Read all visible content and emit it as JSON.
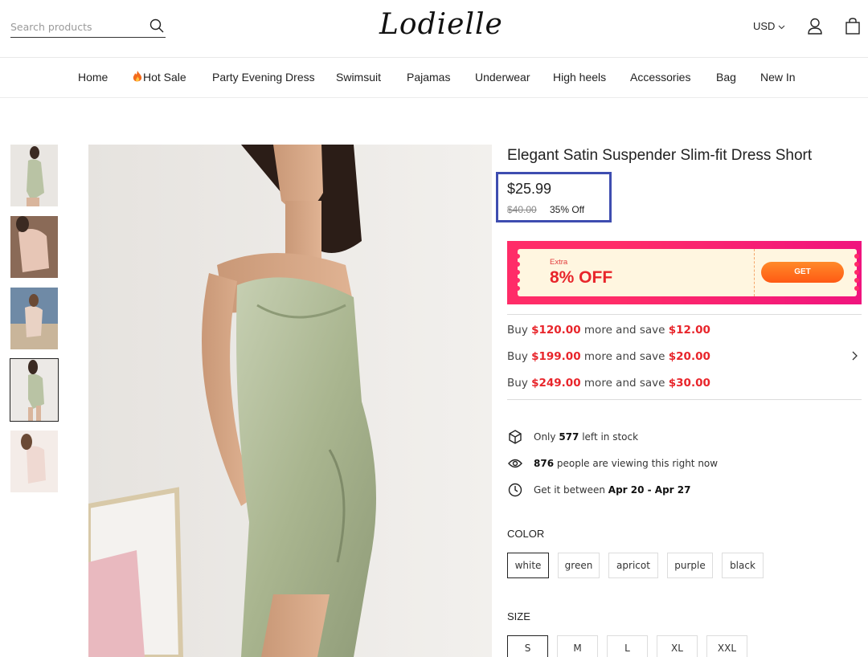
{
  "header": {
    "search_placeholder": "Search products",
    "logo": "Lodielle",
    "currency": "USD"
  },
  "nav": [
    "Home",
    "Hot Sale",
    "Party Evening Dress",
    "Swimsuit",
    "Pajamas",
    "Underwear",
    "High heels",
    "Accessories",
    "Bag",
    "New In"
  ],
  "product": {
    "title": "Elegant Satin Suspender Slim-fit Dress Short",
    "price": "$25.99",
    "old_price": "$40.00",
    "discount": "35% Off",
    "thumbnail_selected_index": 3
  },
  "coupon": {
    "extra_label": "Extra",
    "percent_label": "8% OFF",
    "button": "GET"
  },
  "promotions": [
    {
      "prefix": "Buy",
      "amount": "$120.00",
      "middle": "more and save",
      "save": "$12.00"
    },
    {
      "prefix": "Buy",
      "amount": "$199.00",
      "middle": "more and save",
      "save": "$20.00"
    },
    {
      "prefix": "Buy",
      "amount": "$249.00",
      "middle": "more and save",
      "save": "$30.00"
    }
  ],
  "info": {
    "stock_pre": "Only",
    "stock_count": "577",
    "stock_post": "left in stock",
    "viewers_count": "876",
    "viewers_post": "people are viewing this right now",
    "delivery_pre": "Get it between",
    "delivery_range": "Apr 20 - Apr 27"
  },
  "color": {
    "label": "COLOR",
    "options": [
      "white",
      "green",
      "apricot",
      "purple",
      "black"
    ],
    "selected": "white"
  },
  "size": {
    "label": "SIZE",
    "options": [
      "S",
      "M",
      "L",
      "XL",
      "XXL"
    ],
    "selected": "S"
  },
  "colors": {
    "accent_red": "#e8252b",
    "coupon_pink": "#ff2c68",
    "get_orange": "#ff6a1a",
    "price_box_border": "#3e4db0",
    "dress_green": "#b9c3a4"
  }
}
